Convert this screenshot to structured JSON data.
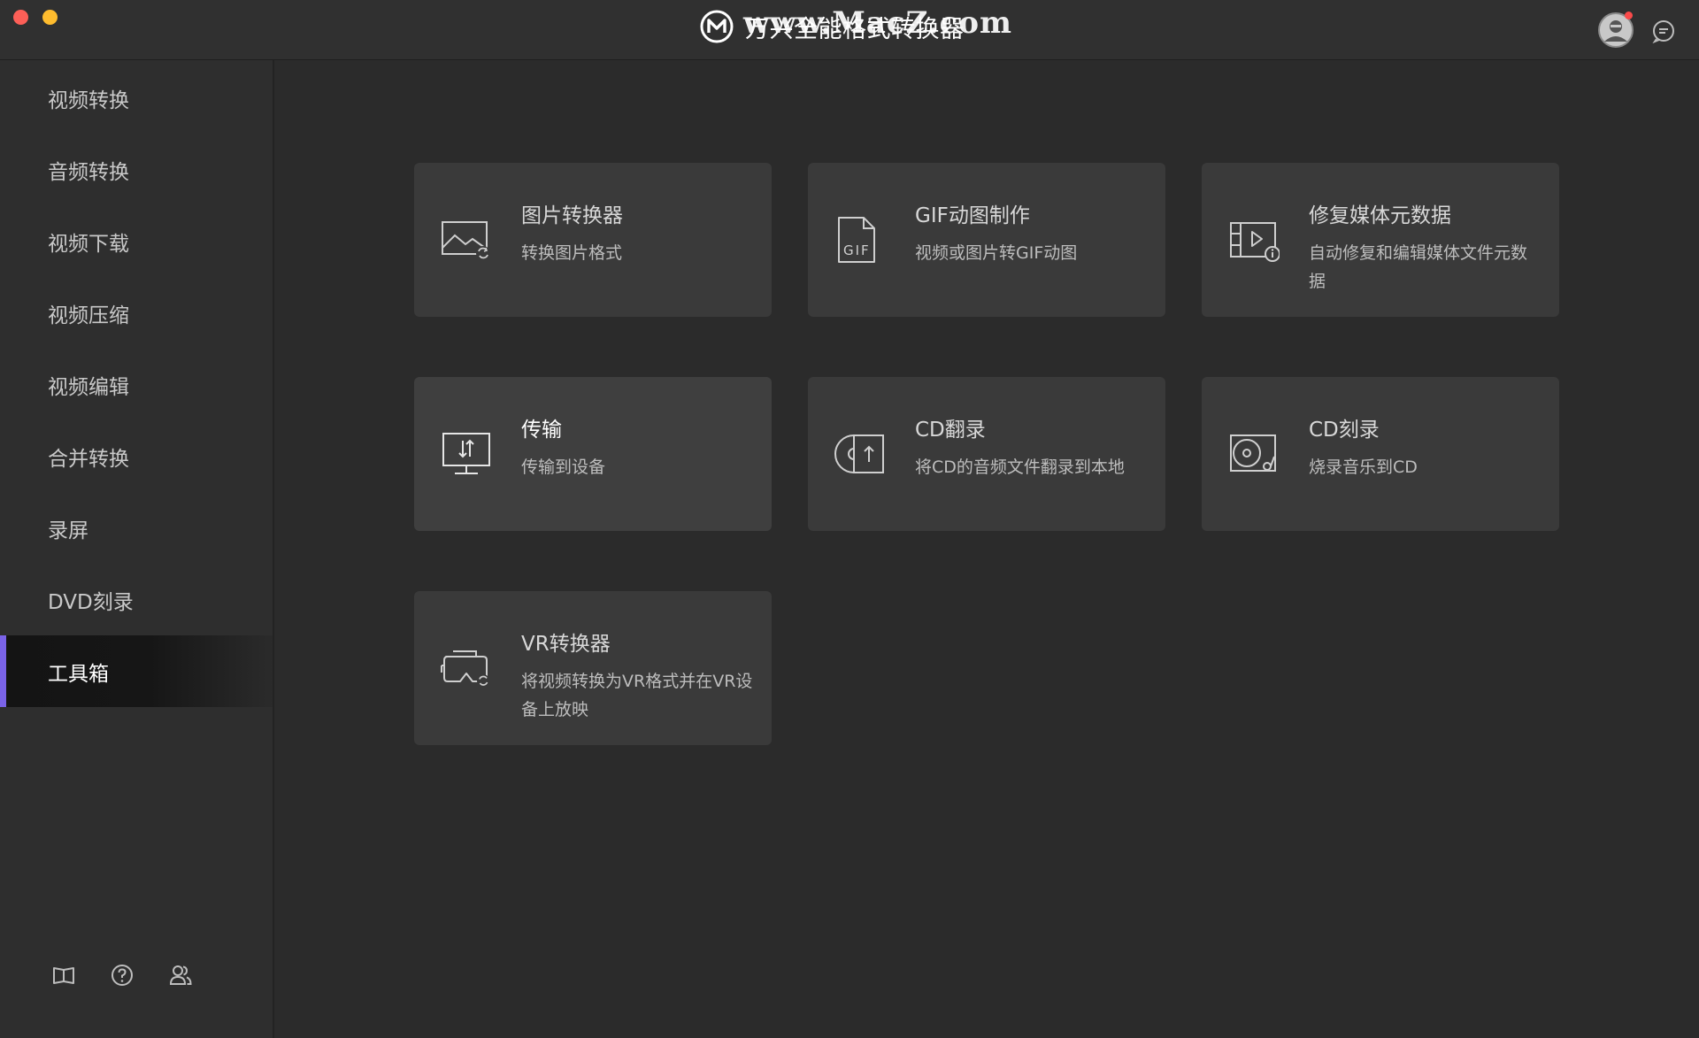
{
  "app": {
    "title": "万兴全能格式转换器",
    "watermark": "www.MacZ.com"
  },
  "colors": {
    "accent": "#7a63e8",
    "background": "#2b2b2b",
    "card": "#3a3a3a",
    "close": "#fd5f57",
    "minimize": "#febc2e",
    "notify": "#fa4a4a"
  },
  "sidebar": {
    "items": [
      {
        "label": "视频转换"
      },
      {
        "label": "音频转换"
      },
      {
        "label": "视频下载"
      },
      {
        "label": "视频压缩"
      },
      {
        "label": "视频编辑"
      },
      {
        "label": "合并转换"
      },
      {
        "label": "录屏"
      },
      {
        "label": "DVD刻录"
      },
      {
        "label": "工具箱",
        "active": true
      }
    ],
    "bottom_icons": [
      "book-icon",
      "help-icon",
      "users-icon"
    ]
  },
  "tools": [
    {
      "title": "图片转换器",
      "desc": "转换图片格式",
      "icon": "image-convert-icon"
    },
    {
      "title": "GIF动图制作",
      "desc": "视频或图片转GIF动图",
      "icon": "gif-icon"
    },
    {
      "title": "修复媒体元数据",
      "desc": "自动修复和编辑媒体文件元数据",
      "icon": "metadata-icon"
    },
    {
      "title": "传输",
      "desc": "传输到设备",
      "icon": "transfer-icon"
    },
    {
      "title": "CD翻录",
      "desc": "将CD的音频文件翻录到本地",
      "icon": "cd-rip-icon"
    },
    {
      "title": "CD刻录",
      "desc": "烧录音乐到CD",
      "icon": "cd-burn-icon"
    },
    {
      "title": "VR转换器",
      "desc": "将视频转换为VR格式并在VR设备上放映",
      "icon": "vr-icon"
    }
  ]
}
